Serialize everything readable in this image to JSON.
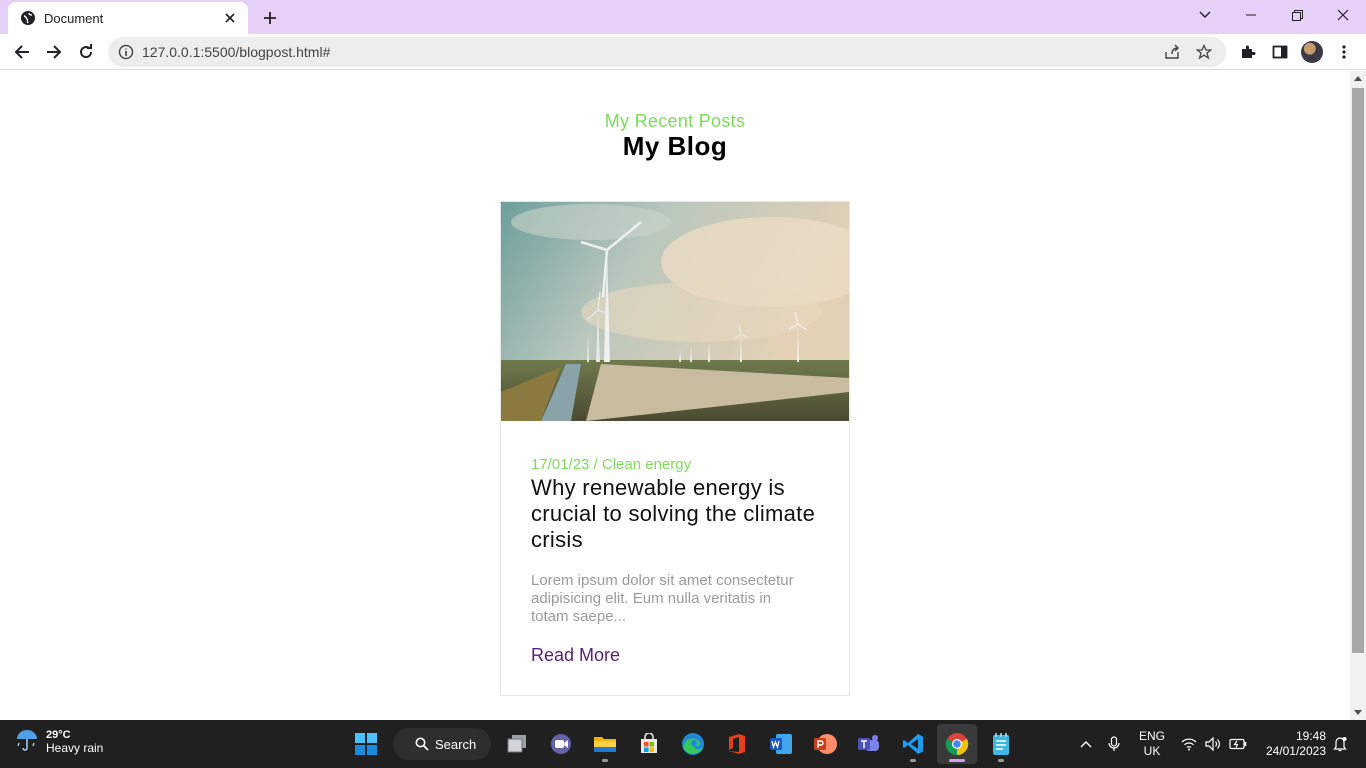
{
  "browser": {
    "tab_title": "Document",
    "url": "127.0.0.1:5500/blogpost.html#"
  },
  "page": {
    "subtitle": "My Recent Posts",
    "heading": "My Blog",
    "post": {
      "meta": "17/01/23 / Clean energy",
      "title": "Why renewable energy is crucial to solving the climate crisis",
      "excerpt": "Lorem ipsum dolor sit amet consectetur adipisicing elit. Eum nulla veritatis in totam saepe...",
      "read_more": "Read More"
    }
  },
  "taskbar": {
    "weather_temp": "29°C",
    "weather_condition": "Heavy rain",
    "search_label": "Search",
    "language_line1": "ENG",
    "language_line2": "UK",
    "time": "19:48",
    "date": "24/01/2023"
  },
  "colors": {
    "accent_green": "#7cdc5a",
    "read_more_purple": "#5b1d7c",
    "tab_strip": "#e5d0f7"
  }
}
